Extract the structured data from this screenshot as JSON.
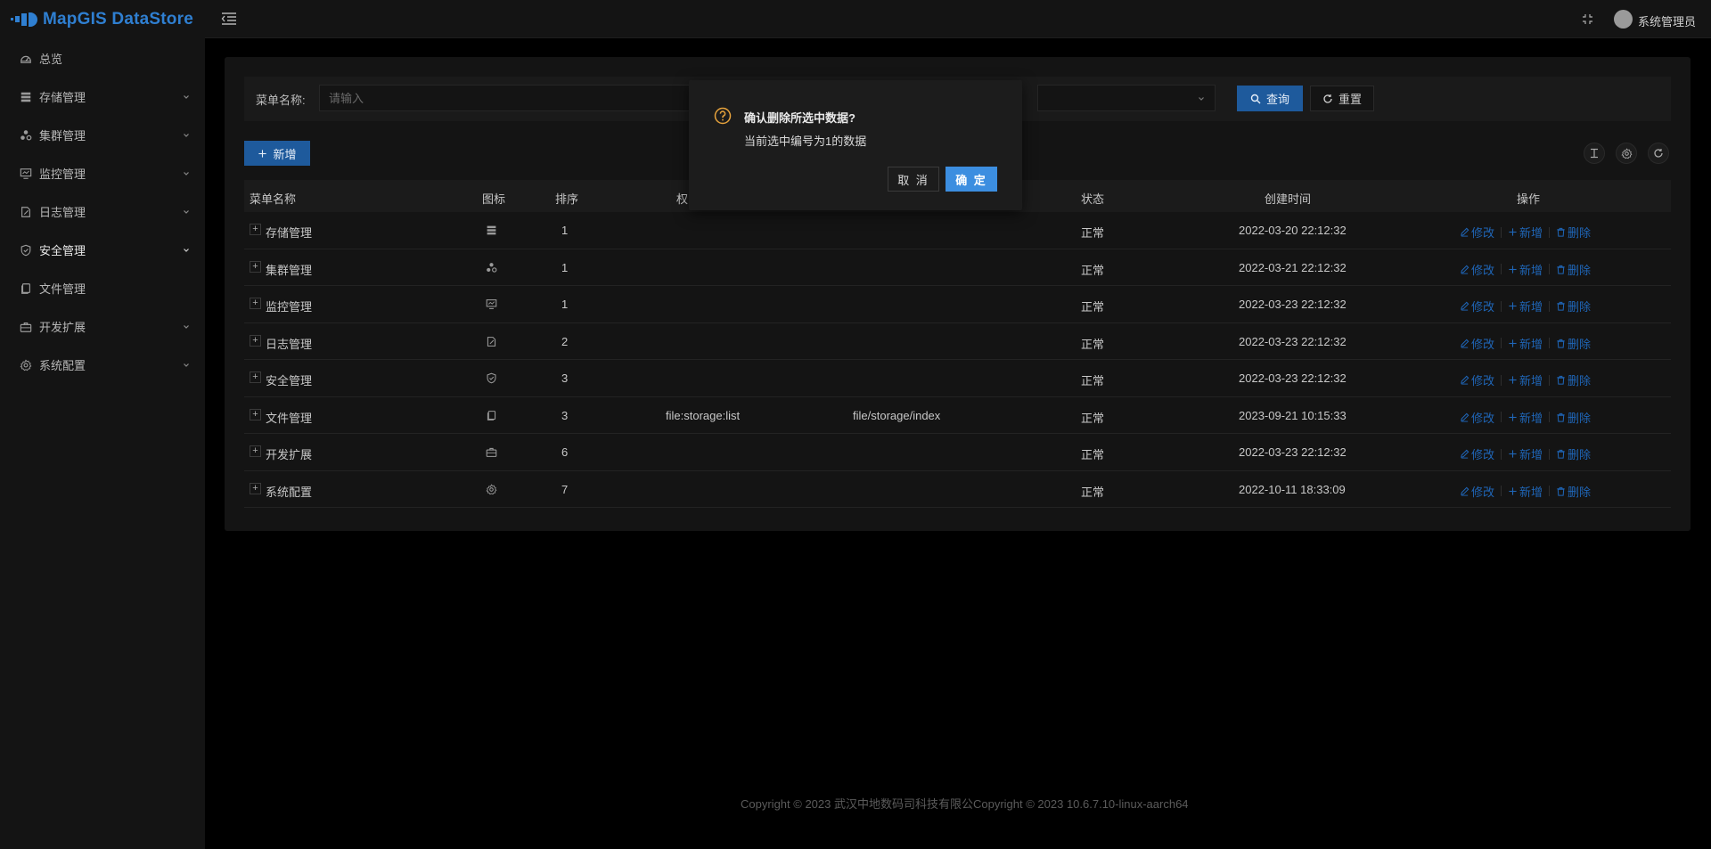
{
  "app": {
    "title": "MapGIS DataStore"
  },
  "sidebar": {
    "items": [
      {
        "label": "总览",
        "icon": "dashboard-icon",
        "expandable": false
      },
      {
        "label": "存储管理",
        "icon": "storage-icon",
        "expandable": true
      },
      {
        "label": "集群管理",
        "icon": "cluster-icon",
        "expandable": true
      },
      {
        "label": "监控管理",
        "icon": "monitor-icon",
        "expandable": true
      },
      {
        "label": "日志管理",
        "icon": "log-icon",
        "expandable": true
      },
      {
        "label": "安全管理",
        "icon": "shield-icon",
        "expandable": true,
        "active": true
      },
      {
        "label": "文件管理",
        "icon": "file-icon",
        "expandable": false
      },
      {
        "label": "开发扩展",
        "icon": "toolbox-icon",
        "expandable": true
      },
      {
        "label": "系统配置",
        "icon": "gear-icon",
        "expandable": true
      }
    ]
  },
  "header": {
    "username": "系统管理员"
  },
  "search": {
    "label": "菜单名称:",
    "placeholder": "请输入",
    "query_label": "查询",
    "reset_label": "重置"
  },
  "toolbar": {
    "add_label": "新增"
  },
  "table": {
    "headers": [
      "菜单名称",
      "图标",
      "排序",
      "权",
      "状态",
      "创建时间",
      "操作"
    ],
    "rows": [
      {
        "name": "存储管理",
        "icon": "storage-icon",
        "order": "1",
        "perm": "",
        "path": "",
        "status": "正常",
        "created": "2022-03-20 22:12:32"
      },
      {
        "name": "集群管理",
        "icon": "cluster-icon",
        "order": "1",
        "perm": "",
        "path": "",
        "status": "正常",
        "created": "2022-03-21 22:12:32"
      },
      {
        "name": "监控管理",
        "icon": "monitor-icon",
        "order": "1",
        "perm": "",
        "path": "",
        "status": "正常",
        "created": "2022-03-23 22:12:32"
      },
      {
        "name": "日志管理",
        "icon": "log-icon",
        "order": "2",
        "perm": "",
        "path": "",
        "status": "正常",
        "created": "2022-03-23 22:12:32"
      },
      {
        "name": "安全管理",
        "icon": "shield-icon",
        "order": "3",
        "perm": "",
        "path": "",
        "status": "正常",
        "created": "2022-03-23 22:12:32"
      },
      {
        "name": "文件管理",
        "icon": "file-icon",
        "order": "3",
        "perm": "file:storage:list",
        "path": "file/storage/index",
        "status": "正常",
        "created": "2023-09-21 10:15:33"
      },
      {
        "name": "开发扩展",
        "icon": "toolbox-icon",
        "order": "6",
        "perm": "",
        "path": "",
        "status": "正常",
        "created": "2022-03-23 22:12:32"
      },
      {
        "name": "系统配置",
        "icon": "gear-icon",
        "order": "7",
        "perm": "",
        "path": "",
        "status": "正常",
        "created": "2022-10-11 18:33:09"
      }
    ],
    "ops": {
      "edit": "修改",
      "add": "新增",
      "delete": "删除"
    }
  },
  "dialog": {
    "title": "确认删除所选中数据?",
    "message": "当前选中编号为1的数据",
    "cancel_label": "取 消",
    "ok_label": "确 定"
  },
  "footer": {
    "text": "Copyright © 2023 武汉中地数码司科技有限公Copyright © 2023 10.6.7.10-linux-aarch64"
  },
  "colors": {
    "accent": "#1e5a9c",
    "link": "#1f66b8",
    "warning": "#e6a23c",
    "dialog_ok": "#3c8ee0"
  }
}
